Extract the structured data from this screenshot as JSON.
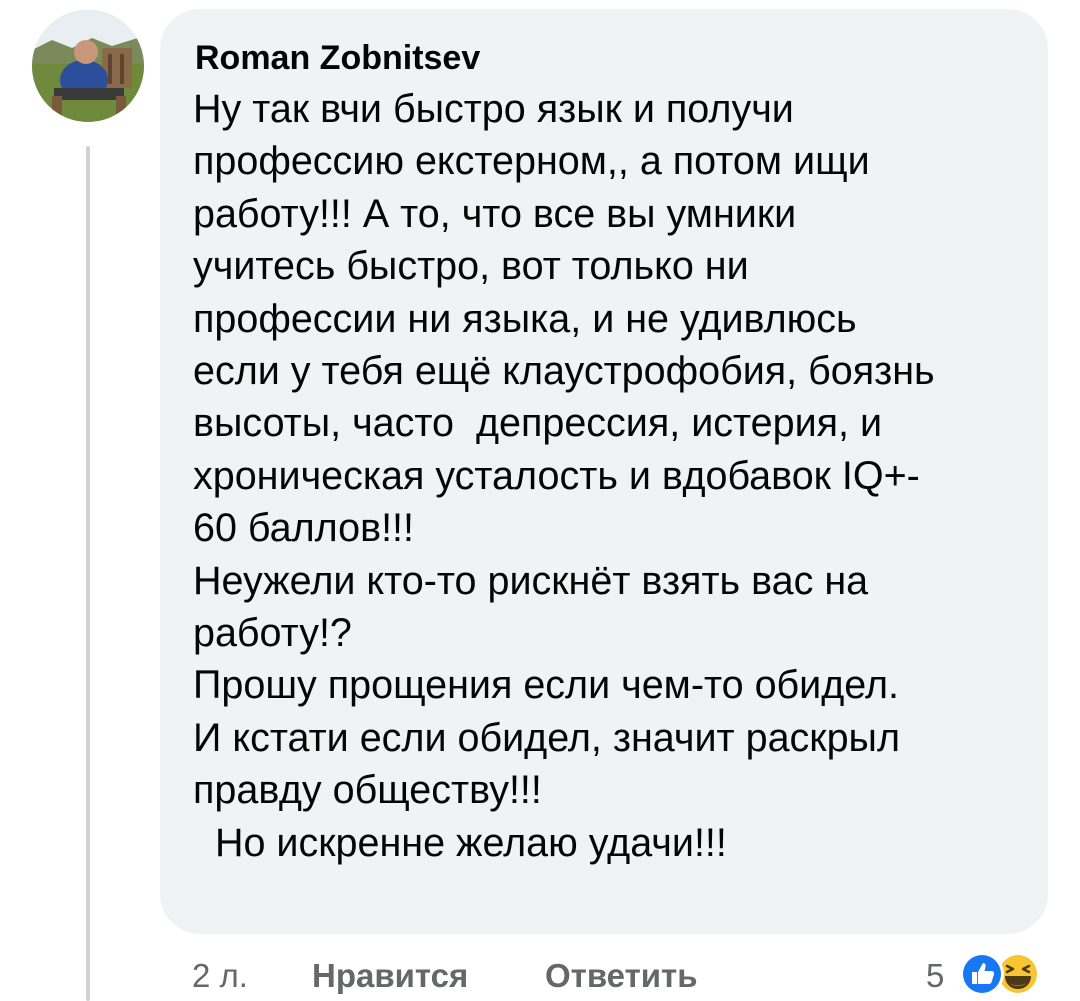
{
  "comment": {
    "author": "Roman Zobnitsev",
    "lines": [
      "Ну так вчи быстро язык и получи",
      "профессию екстерном,, а потом ищи",
      "работу!!! А то, что все вы умники",
      "учитесь быстро, вот только ни",
      "профессии ни языка, и не удивлюсь",
      "если у тебя ещё клаустрофобия, боязнь",
      "высоты, часто  депрессия, истерия, и",
      "хроническая усталость и вдобавок IQ+-",
      "60 баллов!!!",
      "Неужели кто-то рискнёт взять вас на",
      "работу!?",
      "Прошу прощения если чем-то обидел.",
      "И кстати если обидел, значит раскрыл",
      "правду обществу!!!",
      "  Но искренне желаю удачи!!!"
    ]
  },
  "actions": {
    "age": "2 л.",
    "like_label": "Нравится",
    "reply_label": "Ответить",
    "reaction_count": "5"
  },
  "reactions": {
    "icons": [
      "like-icon",
      "haha-icon"
    ],
    "like_color": "#1877f2",
    "haha_color": "#f7c531"
  },
  "colors": {
    "bubble": "#f0f2f5",
    "text": "#050505",
    "secondary_text": "#65676b"
  }
}
